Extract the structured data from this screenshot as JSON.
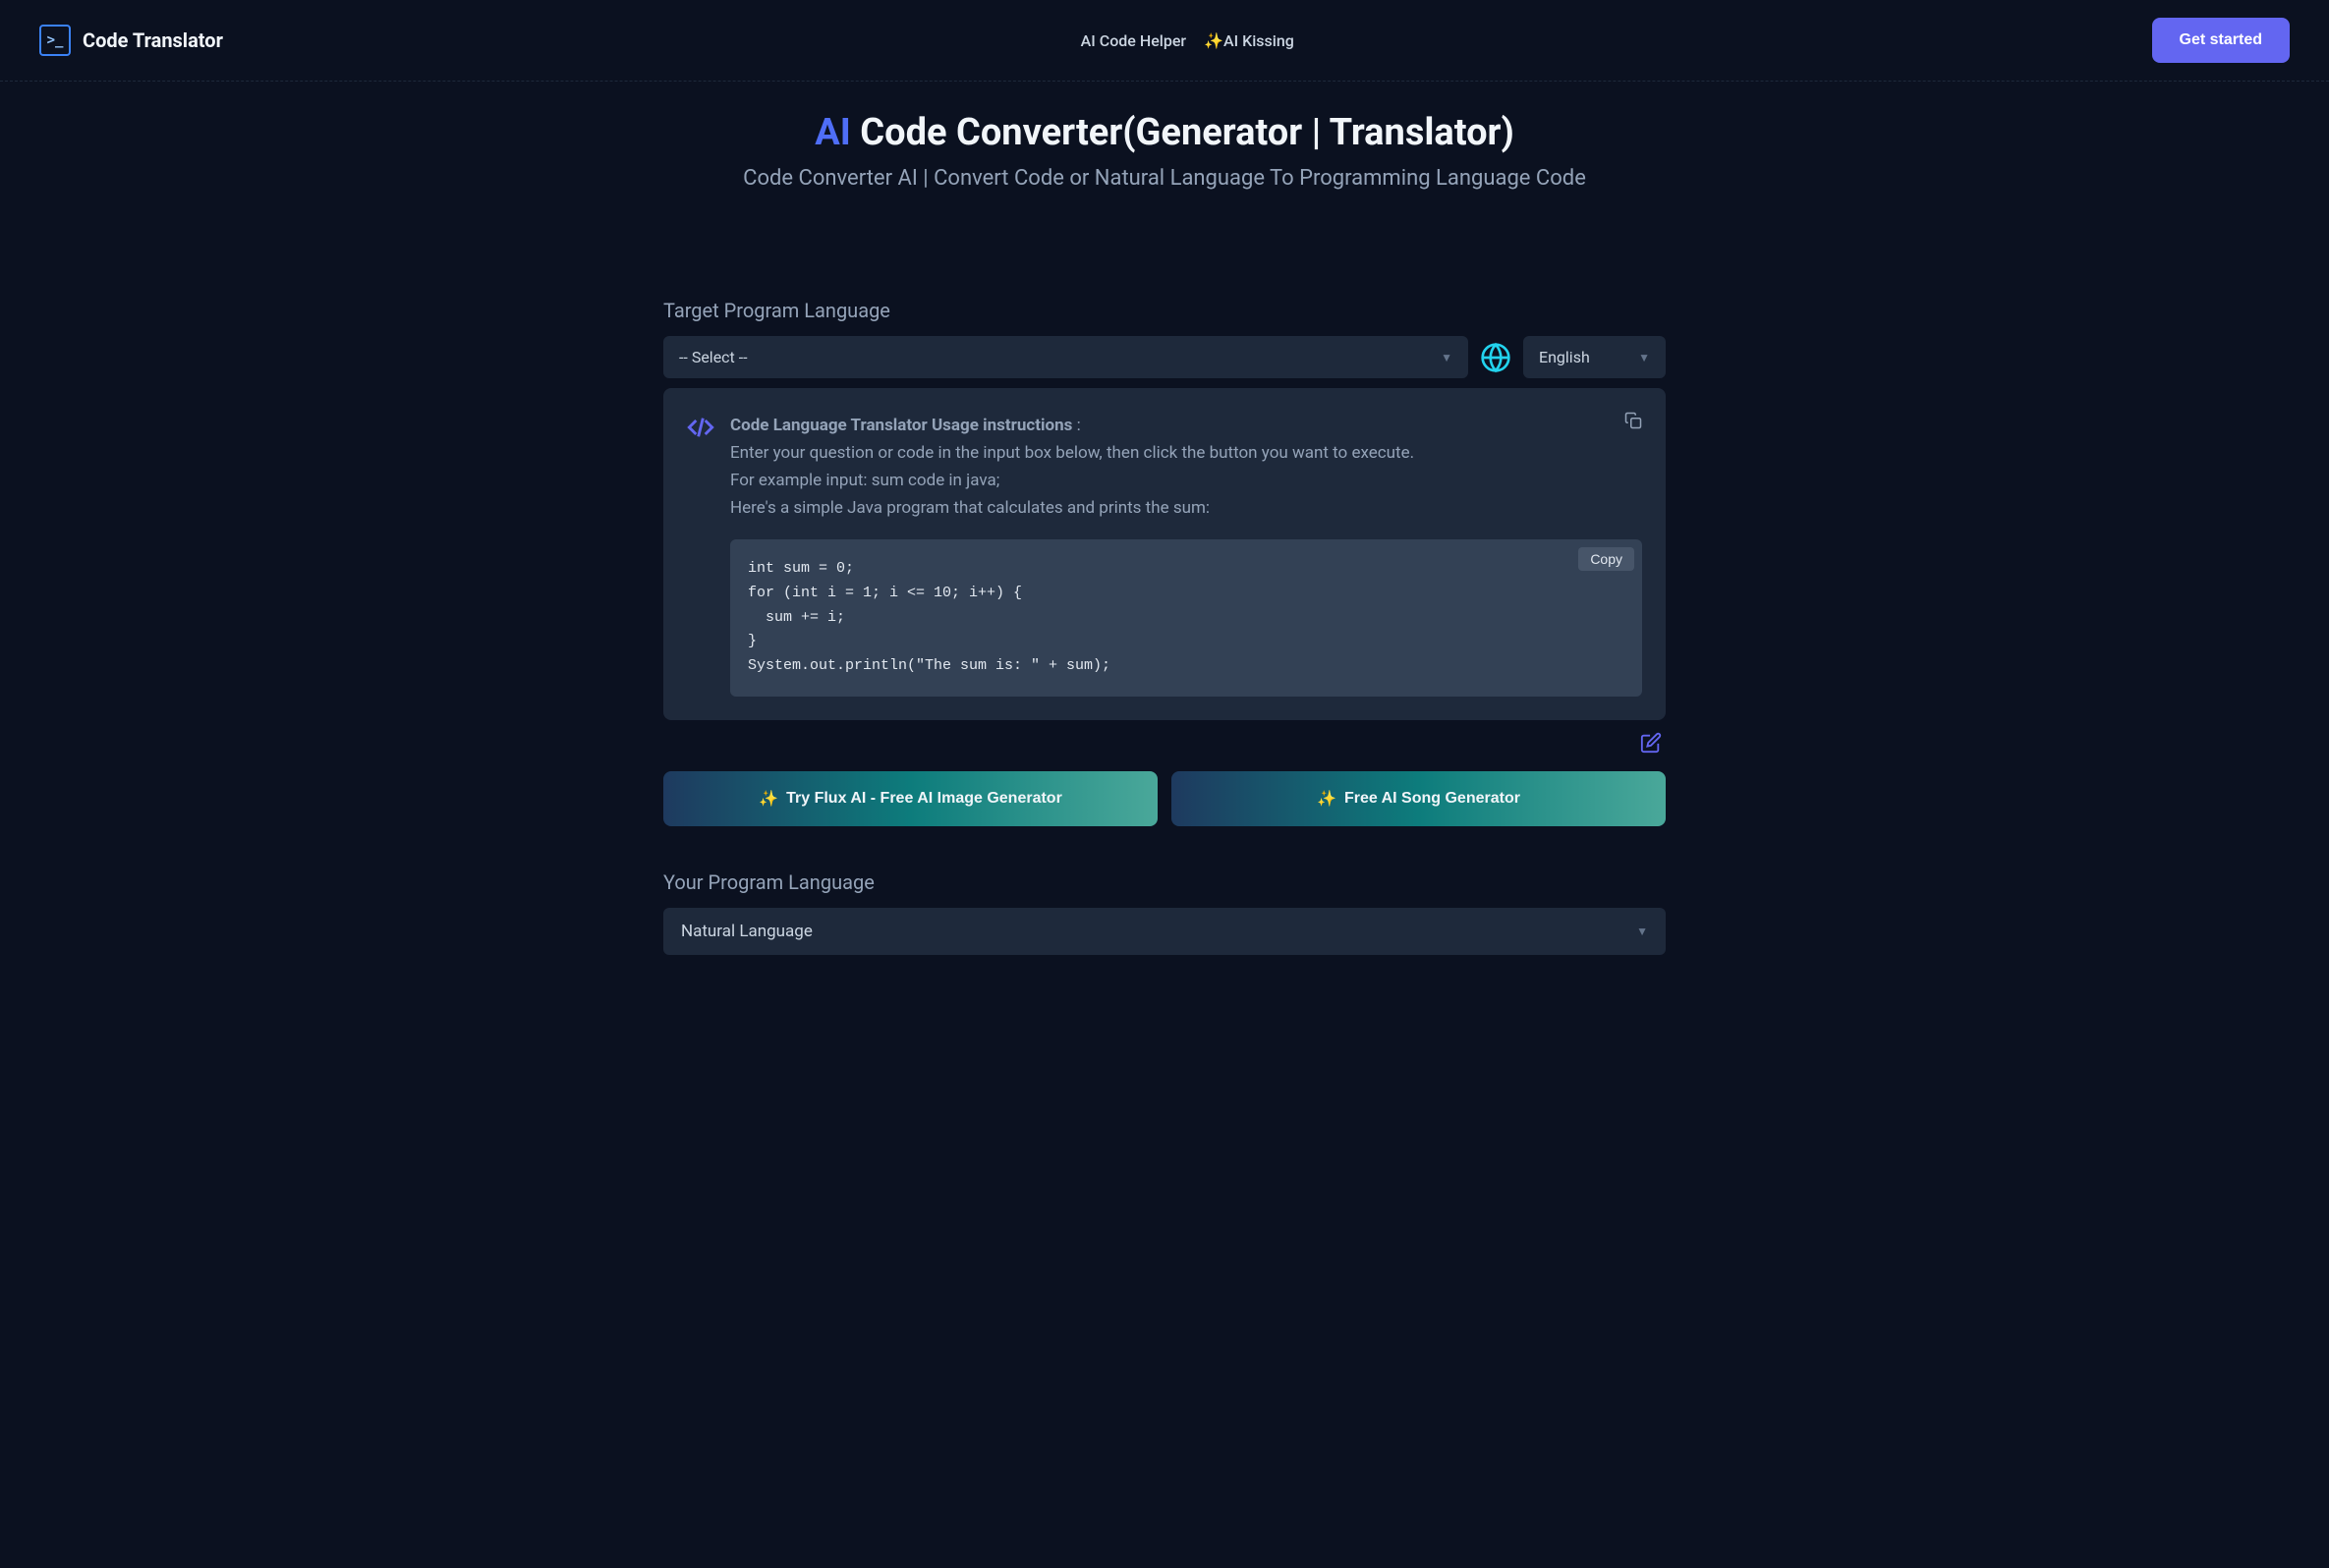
{
  "header": {
    "logo_text": "Code Translator",
    "nav": {
      "ai_code_helper": "AI Code Helper",
      "ai_kissing": "AI Kissing"
    },
    "get_started": "Get started"
  },
  "hero": {
    "ai_prefix": "AI",
    "title_rest": " Code Converter(Generator | Translator)",
    "subtitle": "Code Converter AI | Convert Code or Natural Language To Programming Language Code"
  },
  "target_lang": {
    "label": "Target Program Language",
    "select_placeholder": "-- Select --",
    "english_label": "English"
  },
  "instructions": {
    "title": "Code Language Translator Usage instructions",
    "colon": " :",
    "line1": "Enter your question or code in the input box below, then click the button you want to execute.",
    "line2": "For example input: sum code in java;",
    "line3": "Here's a simple Java program that calculates and prints the sum:",
    "code": "int sum = 0;\nfor (int i = 1; i <= 10; i++) {\n  sum += i;\n}\nSystem.out.println(\"The sum is: \" + sum);",
    "copy_label": "Copy"
  },
  "promo": {
    "flux_ai": "Try Flux AI - Free AI Image Generator",
    "song_gen": "Free AI Song Generator"
  },
  "your_lang": {
    "label": "Your Program Language",
    "selected": "Natural Language"
  }
}
